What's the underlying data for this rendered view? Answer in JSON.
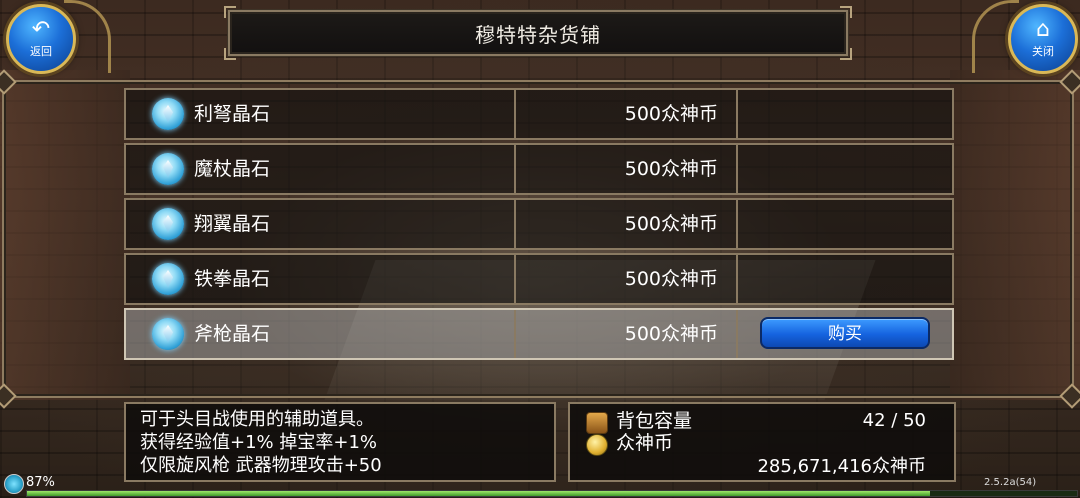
{
  "header": {
    "title": "穆特特杂货铺",
    "back_label": "返回",
    "close_label": "关闭"
  },
  "items": [
    {
      "name": "利弩晶石",
      "price": "500众神币",
      "selected": false
    },
    {
      "name": "魔杖晶石",
      "price": "500众神币",
      "selected": false
    },
    {
      "name": "翔翼晶石",
      "price": "500众神币",
      "selected": false
    },
    {
      "name": "铁拳晶石",
      "price": "500众神币",
      "selected": false
    },
    {
      "name": "斧枪晶石",
      "price": "500众神币",
      "selected": true
    }
  ],
  "buy_label": "购买",
  "description": {
    "line1": "可于头目战使用的辅助道具。",
    "line2": "获得经验值+1% 掉宝率+1%",
    "line3": "仅限旋风枪 武器物理攻击+50"
  },
  "inventory": {
    "bag_label": "背包容量",
    "bag_count": "42 / 50",
    "coin_label": "众神币",
    "coin_total": "285,671,416众神币"
  },
  "status": {
    "battery": "87%",
    "version": "2.5.2a(54)",
    "xp_fill_fraction": 0.86
  },
  "icons": {
    "back": "return-arrow-icon",
    "close": "home-icon",
    "item": "crystal-gem-icon",
    "bag": "bag-icon",
    "coin": "coin-icon"
  },
  "colors": {
    "accent_blue": "#1563df",
    "frame": "#8a7a62",
    "gold_trim": "#d9b857"
  }
}
